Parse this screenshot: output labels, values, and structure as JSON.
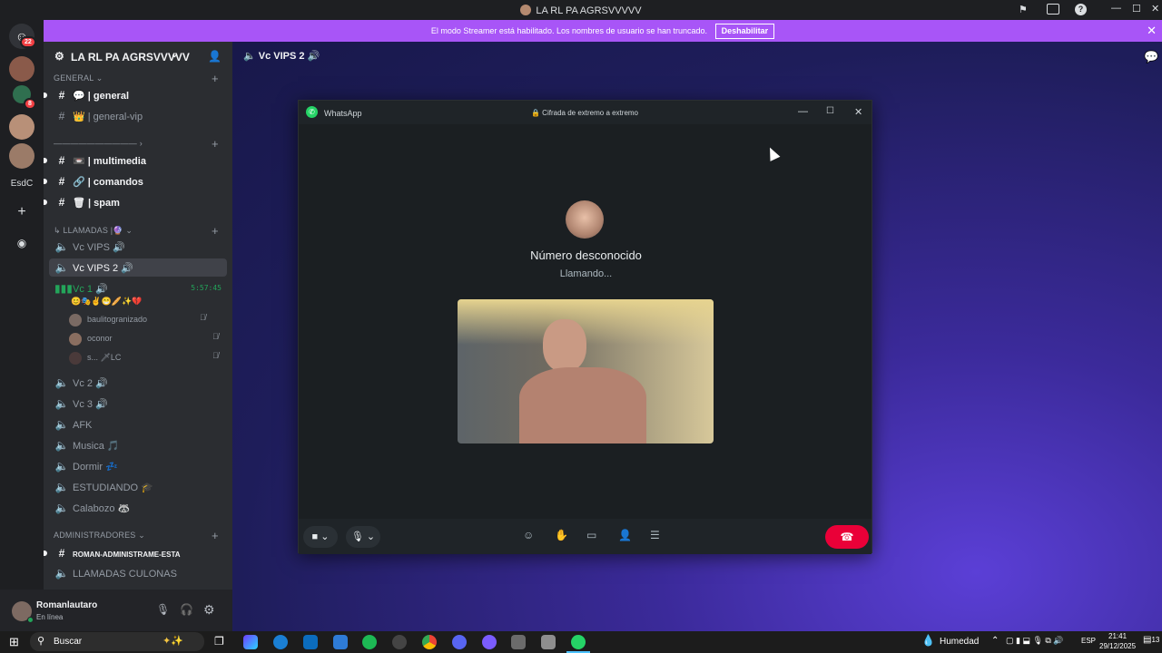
{
  "titlebar": {
    "title": "LA RL PA AGRSVVVVV"
  },
  "banner": {
    "text": "El modo Streamer está habilitado. Los nombres de usuario se han truncado.",
    "button": "Deshabilitar"
  },
  "servers": {
    "home_badge": "22",
    "server_badge": "8",
    "text_server": "EsdC"
  },
  "guild": {
    "name": "LA RL PA AGRSVVVVV"
  },
  "categories": {
    "general": "GENERAL",
    "divider": "——————————",
    "llamadas": "↳ LLAMADAS |🔮",
    "admins": "ADMINISTRADORES"
  },
  "text_channels": [
    {
      "name": "💬 | general",
      "unread": true
    },
    {
      "name": "👑 | general-vip",
      "unread": false
    },
    {
      "name": "📼 | multimedia",
      "unread": true
    },
    {
      "name": "🔗 | comandos",
      "unread": true
    },
    {
      "name": "🗑 | spam",
      "unread": true
    }
  ],
  "voice_channels": [
    {
      "name": "Vc VIPS 🔊"
    },
    {
      "name": "Vc VIPS 2 🔊"
    },
    {
      "name": "Vc 1 🔊",
      "timer": "5:57:45"
    },
    {
      "name": "Vc 2 🔊"
    },
    {
      "name": "Vc 3 🔊"
    },
    {
      "name": "AFK"
    },
    {
      "name": "Musica 🎵"
    },
    {
      "name": "Dormir 💤"
    },
    {
      "name": "ESTUDIANDO 🎓"
    },
    {
      "name": "Calabozo 🦝"
    }
  ],
  "vc1_members": [
    {
      "name": "baulitogranizado"
    },
    {
      "name": "oconor"
    },
    {
      "name": "s... 🗡LC"
    }
  ],
  "admin_channels": [
    {
      "name": "ROMAN-ADMINISTRAME-ESTA"
    },
    {
      "name": "LLAMADAS CULONAS"
    }
  ],
  "user": {
    "name": "Romanlautaro",
    "status": "En línea"
  },
  "header": {
    "channel": "Vc VIPS 2 🔊"
  },
  "whatsapp": {
    "app": "WhatsApp",
    "encryption": "🔒 Cifrada de extremo a extremo",
    "caller": "Número desconocido",
    "status": "Llamando..."
  },
  "taskbar": {
    "search_placeholder": "Buscar",
    "weather": "Humedad",
    "lang": "ESP",
    "time": "21:41",
    "date": "29/12/2025",
    "notif": "13"
  },
  "colors": {
    "accent": "#a855f7",
    "wa_green": "#25d366",
    "end_call": "#ea0038"
  }
}
